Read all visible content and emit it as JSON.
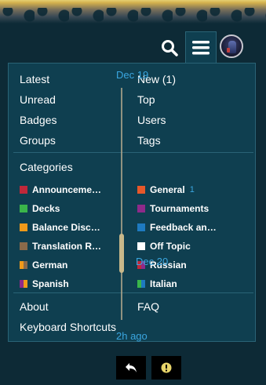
{
  "menu": {
    "nav_left": [
      "Latest",
      "Unread",
      "Badges",
      "Groups"
    ],
    "nav_right": [
      "New (1)",
      "Top",
      "Users",
      "Tags"
    ],
    "categories_heading": "Categories",
    "categories": [
      {
        "label": "Announceme…",
        "color": "#c0283a"
      },
      {
        "label": "General",
        "color": "#e8582a",
        "count": "1"
      },
      {
        "label": "Decks",
        "color": "#3ab54a"
      },
      {
        "label": "Tournaments",
        "color": "#8e2a8a"
      },
      {
        "label": "Balance Disc…",
        "color": "#f09a1a"
      },
      {
        "label": "Feedback an…",
        "color": "#1e7ac0"
      },
      {
        "label": "Translation R…",
        "color": "#8a6a4a"
      },
      {
        "label": "Off Topic",
        "color": "#ffffff"
      },
      {
        "label": "German",
        "color": "#f09a1a",
        "color2": "#8a6a4a"
      },
      {
        "label": "Russian",
        "color": "#c0283a",
        "color2": "#8e2a8a"
      },
      {
        "label": "Spanish",
        "color": "#8e2a8a",
        "color2": "#f09a1a"
      },
      {
        "label": "Italian",
        "color": "#3ab54a",
        "color2": "#1e7ac0"
      }
    ],
    "footer_left": [
      "About",
      "Keyboard Shortcuts"
    ],
    "footer_right": [
      "FAQ"
    ]
  },
  "timeline": {
    "date_top": "Dec 19",
    "date_mid": "Dec 20",
    "date_bottom": "2h ago"
  },
  "icons": {
    "search": "search-icon",
    "menu": "hamburger-icon",
    "reply": "reply-icon",
    "flag": "exclamation-icon"
  }
}
